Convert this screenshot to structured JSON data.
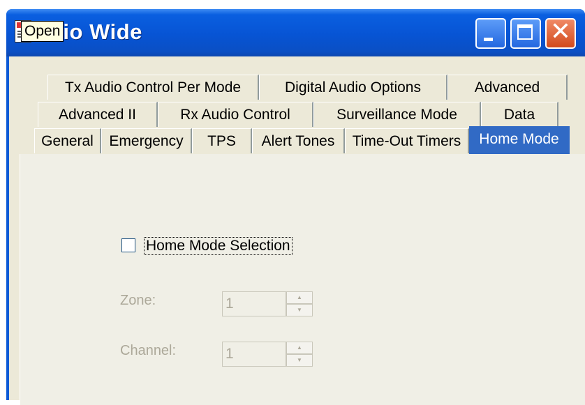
{
  "window": {
    "title": "Radio Wide",
    "visible_title": "dio Wide"
  },
  "tooltip": {
    "text": "Open"
  },
  "controls": {
    "minimize": "minimize-icon",
    "maximize": "maximize-icon",
    "close": "close-icon"
  },
  "tabs": {
    "row1": [
      "Tx Audio Control Per Mode",
      "Digital Audio Options",
      "Advanced"
    ],
    "row2": [
      "Advanced II",
      "Rx Audio Control",
      "Surveillance Mode",
      "Data"
    ],
    "row3": [
      "General",
      "Emergency",
      "TPS",
      "Alert Tones",
      "Time-Out Timers",
      "Home Mode"
    ],
    "active": "Home Mode"
  },
  "home_mode": {
    "checkbox_label": "Home Mode Selection",
    "checked": false,
    "zone_label": "Zone:",
    "zone_value": "1",
    "channel_label": "Channel:",
    "channel_value": "1"
  },
  "colors": {
    "title_bar": "#0754d4",
    "active_tab": "#316ac5",
    "face": "#ece9d8"
  }
}
